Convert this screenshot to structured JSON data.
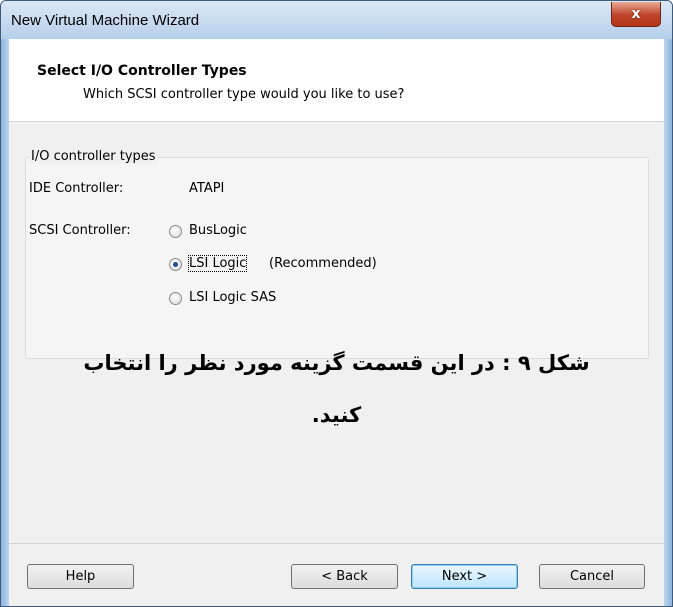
{
  "window": {
    "title": "New Virtual Machine Wizard",
    "close_glyph": "x"
  },
  "header": {
    "title": "Select I/O Controller Types",
    "subtitle": "Which SCSI controller type would you like to use?"
  },
  "controllers": {
    "group_label": "I/O controller types",
    "ide_label": "IDE Controller:",
    "ide_value": "ATAPI",
    "scsi_label": "SCSI Controller:",
    "options": [
      {
        "label": "BusLogic",
        "checked": false
      },
      {
        "label": "LSI Logic",
        "checked": true
      },
      {
        "label": "LSI Logic SAS",
        "checked": false
      }
    ],
    "recommended_note": "(Recommended)"
  },
  "caption": {
    "line1": "شکل ۹ : در این قسمت گزینه مورد نظر را انتخاب",
    "line2": "کنید."
  },
  "buttons": {
    "help": "Help",
    "back": "< Back",
    "next": "Next >",
    "cancel": "Cancel"
  }
}
